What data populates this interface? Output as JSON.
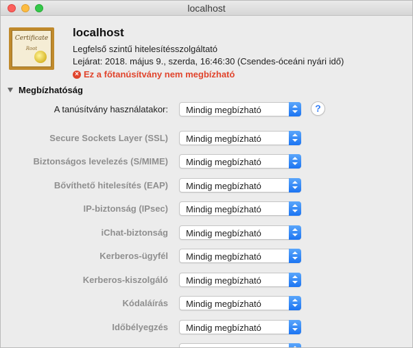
{
  "window": {
    "title": "localhost"
  },
  "certificate": {
    "icon_text_1": "Certificate",
    "icon_text_2": "Root",
    "name": "localhost",
    "issuer": "Legfelső szintű hitelesítésszolgáltató",
    "expiry": "Lejárat: 2018. május 9., szerda, 16:46:30 (Csendes-óceáni nyári idő)",
    "warning": "Ez a főtanúsítvány nem megbízható",
    "warning_color": "#e0442c"
  },
  "trust": {
    "section_title": "Megbízhatóság",
    "help_label": "?",
    "main": {
      "label": "A tanúsítvány használatakor:",
      "value": "Mindig megbízható"
    },
    "items": [
      {
        "label": "Secure Sockets Layer (SSL)",
        "value": "Mindig megbízható"
      },
      {
        "label": "Biztonságos levelezés (S/MIME)",
        "value": "Mindig megbízható"
      },
      {
        "label": "Bővíthető hitelesítés (EAP)",
        "value": "Mindig megbízható"
      },
      {
        "label": "IP-biztonság (IPsec)",
        "value": "Mindig megbízható"
      },
      {
        "label": "iChat-biztonság",
        "value": "Mindig megbízható"
      },
      {
        "label": "Kerberos-ügyfél",
        "value": "Mindig megbízható"
      },
      {
        "label": "Kerberos-kiszolgáló",
        "value": "Mindig megbízható"
      },
      {
        "label": "Kódaláírás",
        "value": "Mindig megbízható"
      },
      {
        "label": "Időbélyegzés",
        "value": "Mindig megbízható"
      }
    ]
  },
  "colors": {
    "accent": "#1b74f2",
    "window_bg": "#ececec"
  }
}
